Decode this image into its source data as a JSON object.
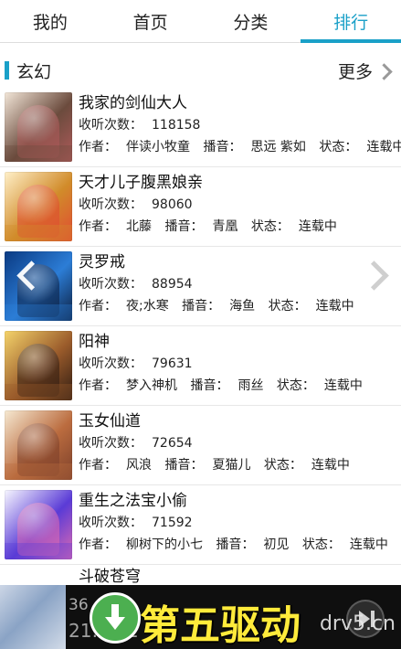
{
  "tabs": [
    {
      "label": "我的"
    },
    {
      "label": "首页"
    },
    {
      "label": "分类"
    },
    {
      "label": "排行",
      "active": true
    }
  ],
  "section": {
    "title": "玄幻",
    "more": "更多"
  },
  "items": [
    {
      "title": "我家的剑仙大人",
      "listens_label": "收听次数：",
      "listens": "118158",
      "author_label": "作者：",
      "author": "伴读小牧童",
      "narrator_label": "播音：",
      "narrator": "思远 紫如",
      "status_label": "状态：",
      "status": "连载中",
      "cover_colors": [
        "#f2e6d8",
        "#6b4b3d",
        "#b05b5b"
      ]
    },
    {
      "title": "天才儿子腹黑娘亲",
      "listens_label": "收听次数：",
      "listens": "98060",
      "author_label": "作者：",
      "author": "北藤",
      "narrator_label": "播音：",
      "narrator": "青凰",
      "status_label": "状态：",
      "status": "连载中",
      "cover_colors": [
        "#fff0c9",
        "#d18b2a",
        "#e14a32"
      ]
    },
    {
      "title": "灵罗戒",
      "listens_label": "收听次数：",
      "listens": "88954",
      "author_label": "作者：",
      "author": "夜;水寒",
      "narrator_label": "播音：",
      "narrator": "海鱼",
      "status_label": "状态：",
      "status": "连载中",
      "cover_colors": [
        "#0a3a83",
        "#2c7dd6",
        "#0b1d3e"
      ]
    },
    {
      "title": "阳神",
      "listens_label": "收听次数：",
      "listens": "79631",
      "author_label": "作者：",
      "author": "梦入神机",
      "narrator_label": "播音：",
      "narrator": "雨丝",
      "status_label": "状态：",
      "status": "连载中",
      "cover_colors": [
        "#f4d36a",
        "#9a5b2b",
        "#2e1b12"
      ]
    },
    {
      "title": "玉女仙道",
      "listens_label": "收听次数：",
      "listens": "72654",
      "author_label": "作者：",
      "author": "风浪",
      "narrator_label": "播音：",
      "narrator": "夏猫儿",
      "status_label": "状态：",
      "status": "连载中",
      "cover_colors": [
        "#f6e9d2",
        "#bb6c3f",
        "#7b3f2a"
      ]
    },
    {
      "title": "重生之法宝小偷",
      "listens_label": "收听次数：",
      "listens": "71592",
      "author_label": "作者：",
      "author": "柳树下的小七",
      "narrator_label": "播音：",
      "narrator": "初见",
      "status_label": "状态：",
      "status": "连载中",
      "cover_colors": [
        "#f7f7ff",
        "#5a3bd6",
        "#e06bb2"
      ]
    }
  ],
  "partial_item": {
    "title": "斗破苍穹"
  },
  "player": {
    "line1": "36",
    "line2": "21:2  32",
    "brand": "第五驱动",
    "watermark": "drv5.cn"
  }
}
